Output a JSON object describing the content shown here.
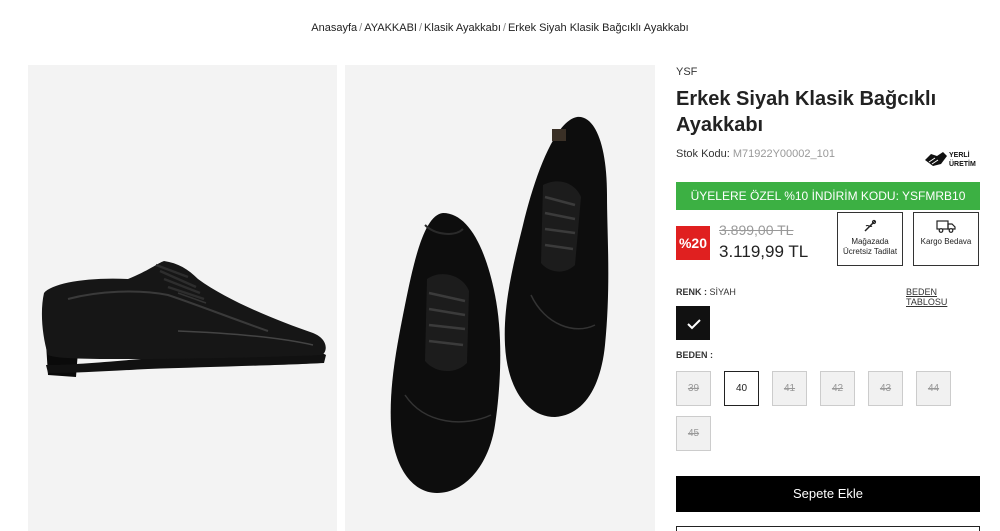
{
  "breadcrumb": {
    "items": [
      "Anasayfa",
      "AYAKKABI",
      "Klasik Ayakkabı",
      "Erkek Siyah Klasik Bağcıklı Ayakkabı"
    ],
    "separator": "/"
  },
  "product": {
    "brand": "YSF",
    "title": "Erkek Siyah Klasik Bağcıklı Ayakkabı",
    "stock_label": "Stok Kodu:",
    "stock_code": "M71922Y00002_101",
    "local_badge": {
      "line1": "YERLİ",
      "line2": "ÜRETİM"
    },
    "promo": "ÜYELERE ÖZEL %10 İNDİRİM KODU: YSFMRB10",
    "discount_badge": "%20",
    "old_price": "3.899,00 TL",
    "new_price": "3.119,99 TL",
    "features": [
      {
        "icon": "needle-icon",
        "label_line1": "Mağazada",
        "label_line2": "Ücretsiz Tadilat"
      },
      {
        "icon": "truck-icon",
        "label_line1": "Kargo Bedava",
        "label_line2": ""
      }
    ],
    "color_label": "RENK :",
    "color_value": "SİYAH",
    "size_table_link": "BEDEN TABLOSU",
    "selected_color": "#111111",
    "size_label": "BEDEN :",
    "sizes": [
      {
        "label": "39",
        "available": false
      },
      {
        "label": "40",
        "available": true
      },
      {
        "label": "41",
        "available": false
      },
      {
        "label": "42",
        "available": false
      },
      {
        "label": "43",
        "available": false
      },
      {
        "label": "44",
        "available": false
      },
      {
        "label": "45",
        "available": false
      }
    ],
    "add_to_cart": "Sepete Ekle"
  },
  "colors": {
    "promo_green": "#3cb043",
    "discount_red": "#e02020",
    "button_black": "#000000"
  }
}
